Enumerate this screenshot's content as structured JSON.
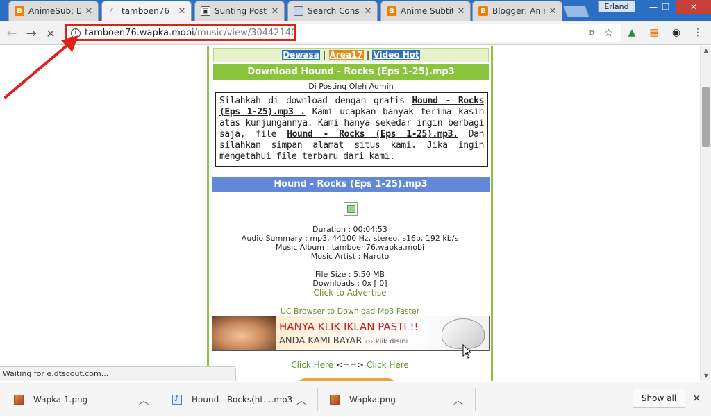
{
  "tabs": [
    {
      "label": "AnimeSub: De",
      "icon": "blogger-icon"
    },
    {
      "label": "tamboen76",
      "icon": "loading-icon",
      "active": true
    },
    {
      "label": "Sunting Posti",
      "icon": "sunting-icon"
    },
    {
      "label": "Search Conso",
      "icon": "search-console-icon"
    },
    {
      "label": "Anime Subtit",
      "icon": "blogger-icon"
    },
    {
      "label": "Blogger: Anin",
      "icon": "blogger-icon"
    }
  ],
  "user_label": "Erland",
  "address": {
    "host": "tamboen76.wapka.mobi",
    "path": "/music/view/30442140"
  },
  "page": {
    "categories": [
      "Dewasa",
      "Area17",
      "Video Hot"
    ],
    "separator": "|",
    "download_title": "Download Hound - Rocks (Eps 1-25).mp3",
    "posted_by": "Di Posting Oleh Admin",
    "description": {
      "p1": "Silahkah di download dengan gratis ",
      "b1": "Hound - Rocks (Eps 1-25).mp3 .",
      "p2": " Kami ucapkan banyak terima kasih atas kunjungannya. Kami hanya sekedar ingin berbagi saja, file ",
      "b2": "Hound - Rocks (Eps 1-25).mp3.",
      "p3": " Dan silahkan simpan alamat situs kami. Jika ingin mengetahui file terbaru dari kami."
    },
    "song_title": "Hound - Rocks (Eps 1-25).mp3",
    "info": {
      "duration": "Duration : 00:04:53",
      "audio_summary": "Audio Summary : mp3, 44100 Hz, stereo, s16p, 192 kb/s",
      "album": "Music Album : tamboen76.wapka.mobi",
      "artist": "Music Artist : Naruto",
      "file_size": "File Size : 5.50 MB",
      "downloads": "Downloads : 0x [ 0]"
    },
    "advertise_link": "Click to Advertise",
    "uc_link": "UC Browser to Download Mp3 Faster",
    "ad": {
      "line1": "HANYA KLIK IKLAN PASTI !!",
      "line2": "ANDA KAMI BAYAR",
      "line2_small": "››› klik disini"
    },
    "click_here": {
      "left": "Click Here",
      "arrow": "<==>",
      "right": "Click Here"
    }
  },
  "status_text": "Waiting for e.dtscout.com...",
  "downloads": [
    {
      "name": "Wapka 1.png",
      "icon": "image-file-icon"
    },
    {
      "name": "Hound - Rocks(ht....mp3",
      "icon": "audio-file-icon"
    },
    {
      "name": "Wapka.png",
      "icon": "image-file-icon"
    }
  ],
  "show_all_label": "Show all",
  "colors": {
    "highlight": "#e0201a",
    "page_green": "#8ac33c",
    "song_bar": "#6289d8"
  }
}
